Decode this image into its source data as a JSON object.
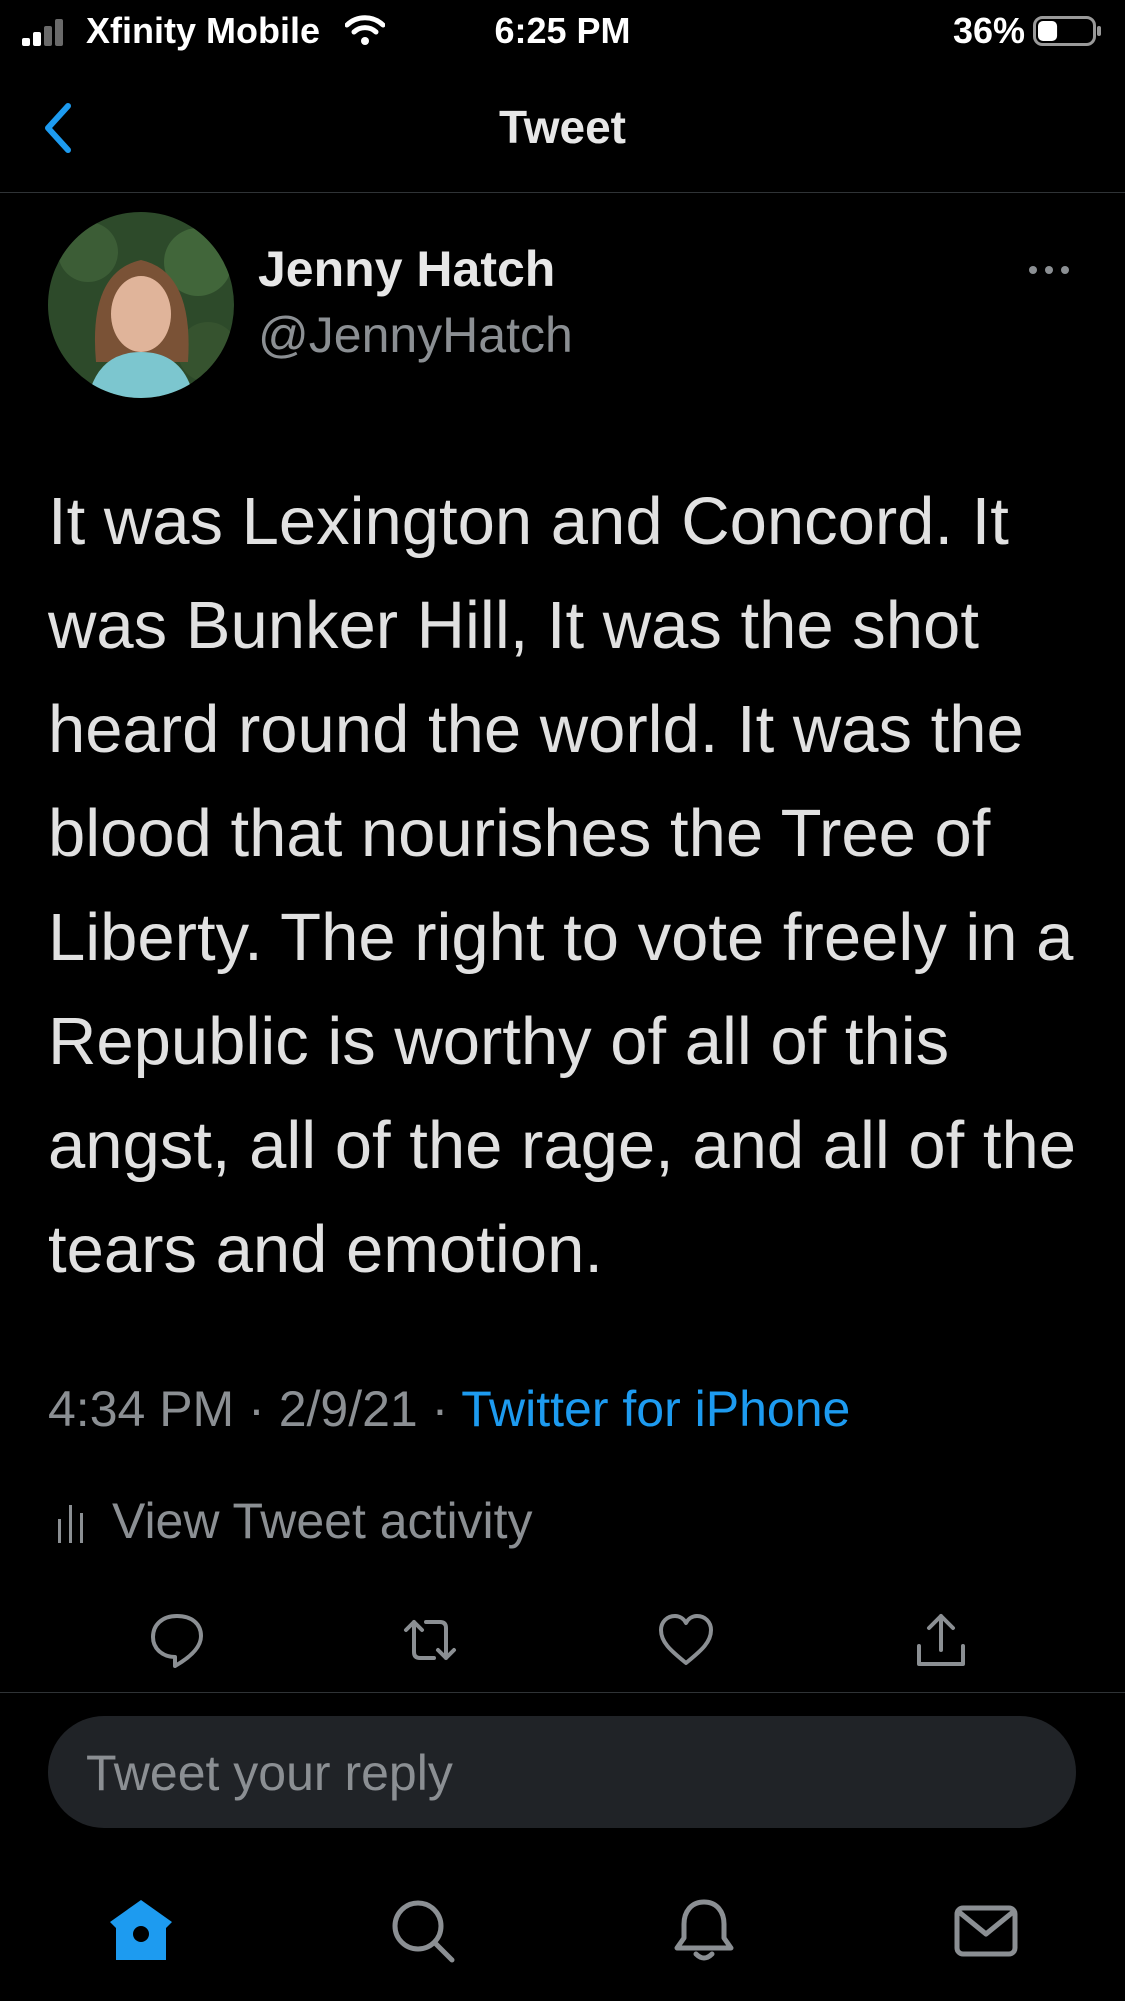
{
  "status_bar": {
    "carrier": "Xfinity Mobile",
    "time": "6:25 PM",
    "battery_percent": "36%",
    "battery_level": 0.36,
    "icons": [
      "signal-icon",
      "wifi-icon",
      "battery-icon"
    ]
  },
  "nav": {
    "title": "Tweet",
    "back_icon": "chevron-left-icon"
  },
  "tweet": {
    "author_name": "Jenny Hatch",
    "author_handle": "@JennyHatch",
    "text": "It was Lexington and Concord. It was Bunker Hill, It was the shot heard round the world. It was the blood that nourishes the Tree of Liberty. The right to vote freely in a Republic is worthy of all of this angst, all of the rage, and all of the tears and emotion.",
    "time": "4:34 PM",
    "date": "2/9/21",
    "separator": "·",
    "source": "Twitter for iPhone",
    "activity_label": "View Tweet activity"
  },
  "actions": [
    "reply-icon",
    "retweet-icon",
    "like-icon",
    "share-icon"
  ],
  "reply_box": {
    "placeholder": "Tweet your reply"
  },
  "tab_bar": [
    "home-icon",
    "search-icon",
    "notifications-icon",
    "messages-icon"
  ],
  "colors": {
    "background": "#000000",
    "accent": "#1d9bf0",
    "secondary_text": "#8b8f93",
    "primary_text": "#e1e1e1",
    "reply_bg": "#202327",
    "divider": "#2f3336"
  }
}
